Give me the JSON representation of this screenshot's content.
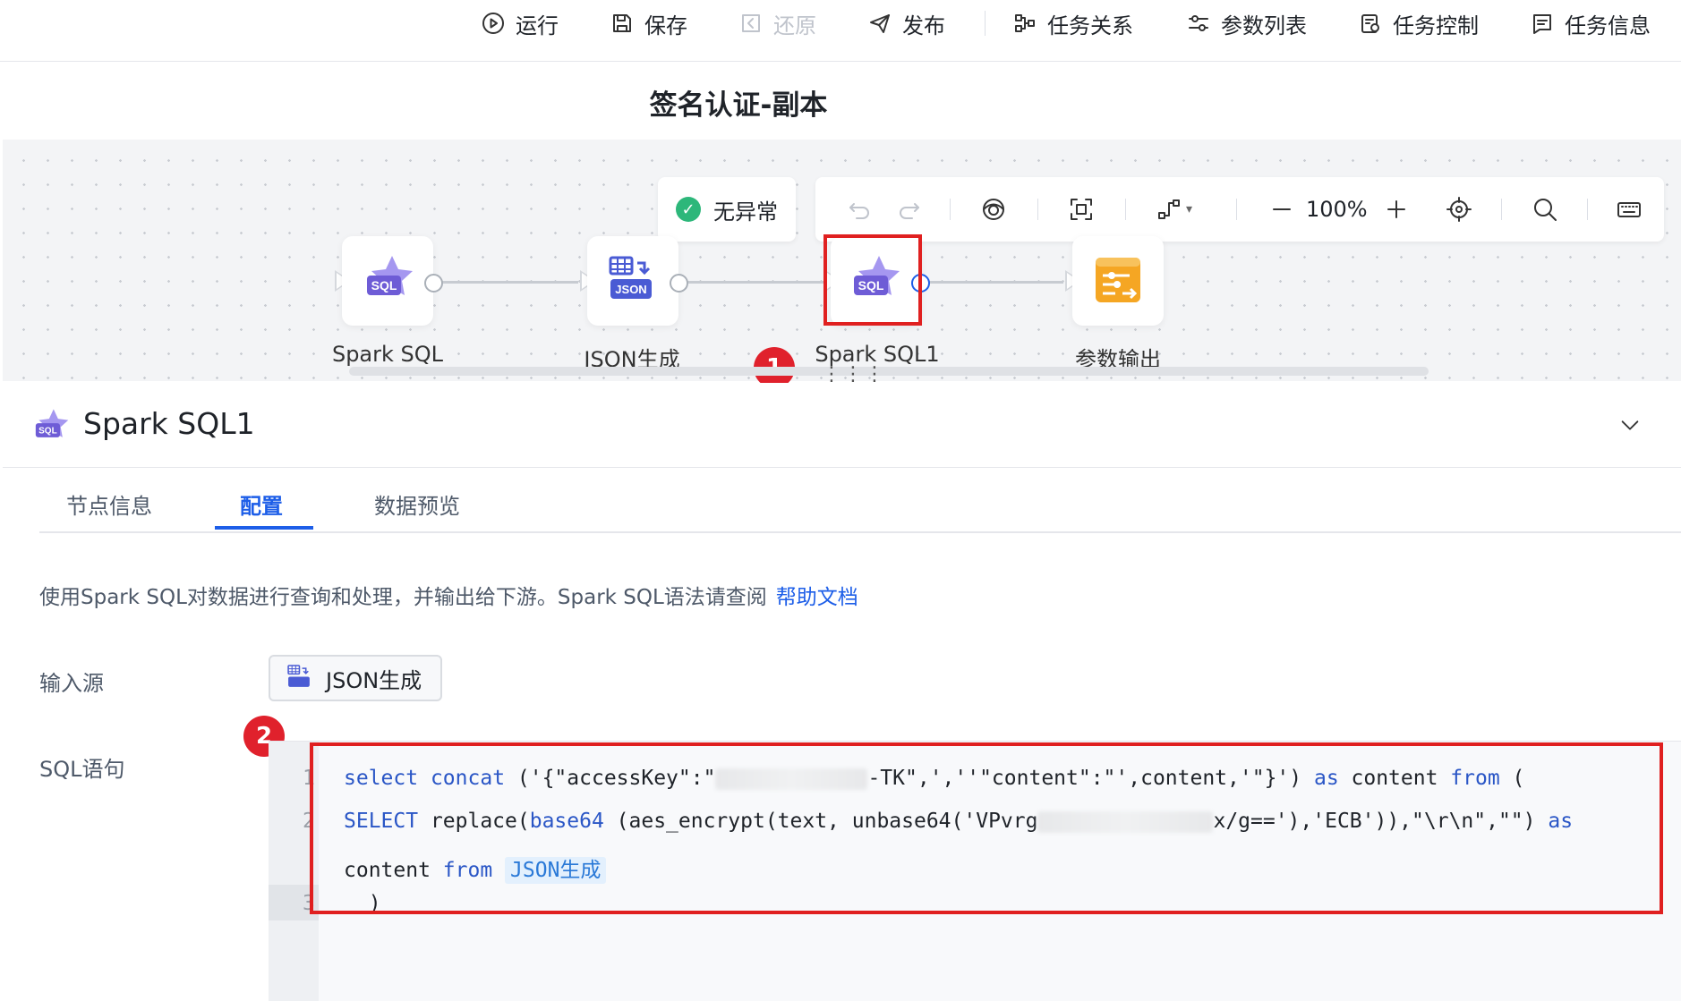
{
  "toolbar": {
    "run": "运行",
    "save": "保存",
    "restore": "还原",
    "publish": "发布",
    "task_relation": "任务关系",
    "param_list": "参数列表",
    "task_control": "任务控制",
    "task_info": "任务信息"
  },
  "page_title": "签名认证-副本",
  "canvas": {
    "status": "无异常",
    "zoom": "100%",
    "nodes": [
      {
        "label": "Spark SQL",
        "icon": "spark-sql-icon"
      },
      {
        "label": "JSON生成",
        "icon": "json-generate-icon"
      },
      {
        "label": "Spark SQL1",
        "icon": "spark-sql-icon",
        "selected": true
      },
      {
        "label": "参数输出",
        "icon": "param-output-icon"
      }
    ],
    "badge1": "1",
    "badge2": "2",
    "sql_tag": "SQL",
    "json_tag": "JSON"
  },
  "detail": {
    "title": "Spark SQL1",
    "tabs": [
      "节点信息",
      "配置",
      "数据预览"
    ],
    "active_tab": "配置",
    "description": "使用Spark SQL对数据进行查询和处理，并输出给下游。Spark SQL语法请查阅",
    "help_link": "帮助文档",
    "input_source_label": "输入源",
    "input_source_value": "JSON生成",
    "sql_label": "SQL语句"
  },
  "code": {
    "line_numbers": [
      "1",
      "2",
      "3"
    ],
    "l1_kw1": "select",
    "l1_fn": "concat",
    "l1_text1": " ('{\"accessKey\":\"",
    "l1_text2": "-TK\",',''\"content\":\"',content,'\"}')",
    "l1_kw2": "as",
    "l1_text3": " content ",
    "l1_kw3": "from",
    "l1_text4": " (",
    "l2_kw1": "SELECT",
    "l2_text1": " replace(",
    "l2_fn": "base64",
    "l2_text2": " (aes_encrypt(text, unbase64('VPvrg",
    "l2_text3": "x/g=='),'ECB')),\"\\r\\n\",\"\")",
    "l2_kw2": "as",
    "l3_text1": "content ",
    "l3_kw": "from",
    "l3_tag": "JSON生成",
    "l4_text": "  )"
  },
  "colors": {
    "accent": "#1d5ee8",
    "highlight": "#e02020",
    "success": "#2db77a",
    "sql_purple": "#6e5cd6",
    "output_orange": "#f5a623"
  }
}
